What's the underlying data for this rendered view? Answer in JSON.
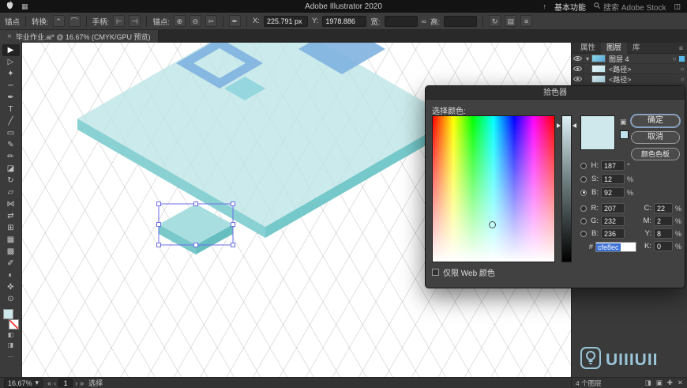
{
  "menubar": {
    "title": "Adobe Illustrator 2020",
    "workspace": "基本功能",
    "workspace_caret": "▾",
    "search": "搜索 Adobe Stock"
  },
  "controlbar": {
    "anchor": "锚点",
    "convert": "转换:",
    "handles": "手柄:",
    "anchors": "锚点:",
    "x_label": "X:",
    "x_value": "225.791 px",
    "y_label": "Y:",
    "y_value": "1978.886",
    "w_label": "宽:",
    "h_label": "高:"
  },
  "tab": {
    "close": "×",
    "title": "毕业作业.ai* @ 16.67% (CMYK/GPU 预览)"
  },
  "tools": [
    {
      "name": "selection-tool",
      "glyph": "▶"
    },
    {
      "name": "direct-selection-tool",
      "glyph": "▷"
    },
    {
      "name": "magic-wand-tool",
      "glyph": "✦"
    },
    {
      "name": "lasso-tool",
      "glyph": "∽"
    },
    {
      "name": "pen-tool",
      "glyph": "✒"
    },
    {
      "name": "type-tool",
      "glyph": "T"
    },
    {
      "name": "line-segment-tool",
      "glyph": "╱"
    },
    {
      "name": "rectangle-tool",
      "glyph": "▭"
    },
    {
      "name": "paintbrush-tool",
      "glyph": "✎"
    },
    {
      "name": "pencil-tool",
      "glyph": "✏"
    },
    {
      "name": "eraser-tool",
      "glyph": "◪"
    },
    {
      "name": "rotate-tool",
      "glyph": "↻"
    },
    {
      "name": "scale-tool",
      "glyph": "▱"
    },
    {
      "name": "width-tool",
      "glyph": "⋈"
    },
    {
      "name": "free-transform-tool",
      "glyph": "⇄"
    },
    {
      "name": "shape-builder-tool",
      "glyph": "⊞"
    },
    {
      "name": "mesh-tool",
      "glyph": "▦"
    },
    {
      "name": "gradient-tool",
      "glyph": "▩"
    },
    {
      "name": "eyedropper-tool",
      "glyph": "✐"
    },
    {
      "name": "blend-tool",
      "glyph": "◐"
    },
    {
      "name": "hand-tool",
      "glyph": "✜"
    },
    {
      "name": "zoom-tool",
      "glyph": "⊙"
    }
  ],
  "icons": {
    "apps_grid": "▦",
    "share": "↑",
    "switcher": "◫",
    "convert_corner": "⌃",
    "convert_smooth": "⌒",
    "handle_show": "⊢",
    "handle_hide": "⊣",
    "anchor_add": "⊕",
    "anchor_remove": "⊖",
    "anchor_cut": "✂",
    "pen_icon": "✒",
    "link": "∞",
    "transform": "↻",
    "align": "▤",
    "panel_menu": "≡",
    "more": "…",
    "draw_mode_a": "◧",
    "draw_mode_b": "◨",
    "chevron_down": "▾",
    "nav_first": "«",
    "nav_prev": "‹",
    "nav_next": "›",
    "nav_last": "»",
    "layer_chevron": "▾",
    "target_circle": "○",
    "cube": "▣",
    "make_mask": "◨",
    "new_sublayer": "▣",
    "new_layer": "✚",
    "delete_layer": "✕"
  },
  "dialog": {
    "title": "拾色器",
    "select_label": "选择颜色:",
    "ok": "确定",
    "cancel": "取消",
    "swatches": "颜色色板",
    "web_only": "仅限 Web 颜色",
    "picked_color": "#cfe8ec",
    "web_safe_color": "#bfe2ec",
    "hsb": [
      {
        "label": "H:",
        "value": "187",
        "unit": "°"
      },
      {
        "label": "S:",
        "value": "12",
        "unit": "%"
      },
      {
        "label": "B:",
        "value": "92",
        "unit": "%"
      }
    ],
    "rgb": [
      {
        "label": "R:",
        "value": "207"
      },
      {
        "label": "G:",
        "value": "232"
      },
      {
        "label": "B:",
        "value": "236"
      }
    ],
    "cmyk": [
      {
        "label": "C:",
        "value": "22",
        "unit": "%"
      },
      {
        "label": "M:",
        "value": "2",
        "unit": "%"
      },
      {
        "label": "Y:",
        "value": "8",
        "unit": "%"
      },
      {
        "label": "K:",
        "value": "0",
        "unit": "%"
      }
    ],
    "hex_label": "#",
    "hex": "cfe8ec"
  },
  "panels": {
    "tabs": [
      {
        "label": "属性"
      },
      {
        "label": "图层"
      },
      {
        "label": "库"
      }
    ],
    "layers": [
      {
        "name": "图层 4"
      },
      {
        "name": "<路径>"
      },
      {
        "name": "<路径>"
      }
    ],
    "layer_count": "4 个图层"
  },
  "statusbar": {
    "zoom": "16.67%",
    "artboard": "1",
    "status": "选择"
  },
  "watermark": {
    "text": "UIIIUII"
  },
  "colors": {
    "slab_top": "#bce4e6",
    "slab_left": "#84cfd1",
    "slab_right": "#6fc6c8",
    "accent_blue": "#7fb3e0",
    "selection": "#6e6ee8",
    "toolbar_fill": "#cfe8ec"
  }
}
